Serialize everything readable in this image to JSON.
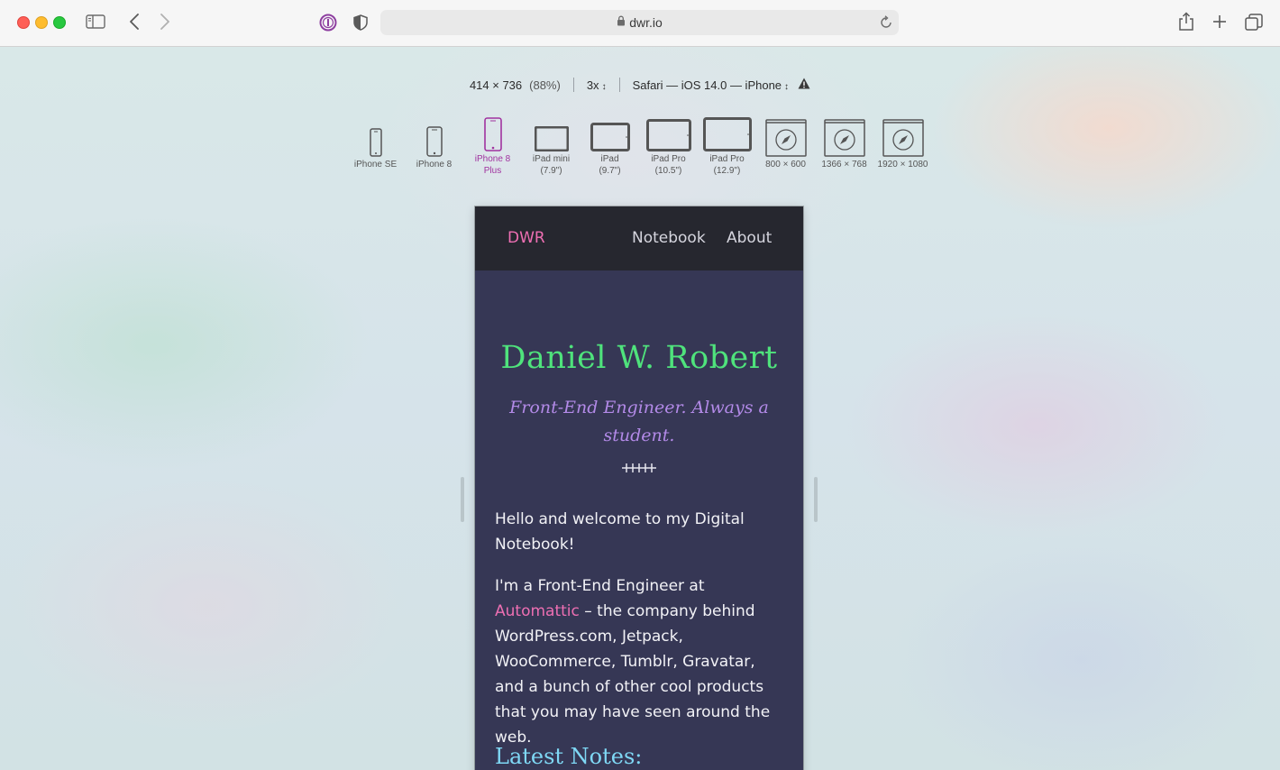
{
  "browser": {
    "url": "dwr.io",
    "icons": [
      "sidebar-icon",
      "back-icon",
      "forward-icon",
      "onepassword-icon",
      "privacy-shield-icon",
      "lock-icon",
      "reload-icon",
      "share-icon",
      "new-tab-icon",
      "tab-overview-icon"
    ]
  },
  "responsive": {
    "dimensions": "414 × 736",
    "zoom": "(88%)",
    "scale": "3x",
    "user_agent": "Safari — iOS 14.0 — iPhone",
    "devices": [
      {
        "line1": "iPhone SE",
        "line2": ""
      },
      {
        "line1": "iPhone 8",
        "line2": ""
      },
      {
        "line1": "iPhone 8",
        "line2": "Plus"
      },
      {
        "line1": "iPad mini",
        "line2": "(7.9\")"
      },
      {
        "line1": "iPad",
        "line2": "(9.7\")"
      },
      {
        "line1": "iPad Pro",
        "line2": "(10.5\")"
      },
      {
        "line1": "iPad Pro",
        "line2": "(12.9\")"
      },
      {
        "line1": "800 × 600",
        "line2": ""
      },
      {
        "line1": "1366 × 768",
        "line2": ""
      },
      {
        "line1": "1920 × 1080",
        "line2": ""
      }
    ],
    "active_device_index": 2,
    "active_color": "#a0329f"
  },
  "site": {
    "brand": "DWR",
    "nav": [
      "Notebook",
      "About"
    ],
    "title": "Daniel W. Robert",
    "subtitle": "Front-End Engineer. Always a student.",
    "intro": "Hello and welcome to my Digital Notebook!",
    "body_prefix": "I'm a Front-End Engineer at ",
    "body_link": "Automattic",
    "body_suffix": " – the company behind WordPress.com, Jetpack, WooCommerce, Tumblr, Gravatar, and a bunch of other cool products that you may have seen around the web.",
    "latest_heading": "Latest Notes:",
    "colors": {
      "brand": "#ee6fb3",
      "title": "#4fe37c",
      "subtitle": "#b38ae8",
      "heading": "#7fd8f5",
      "background": "#363755",
      "nav_background": "#26272f"
    }
  }
}
